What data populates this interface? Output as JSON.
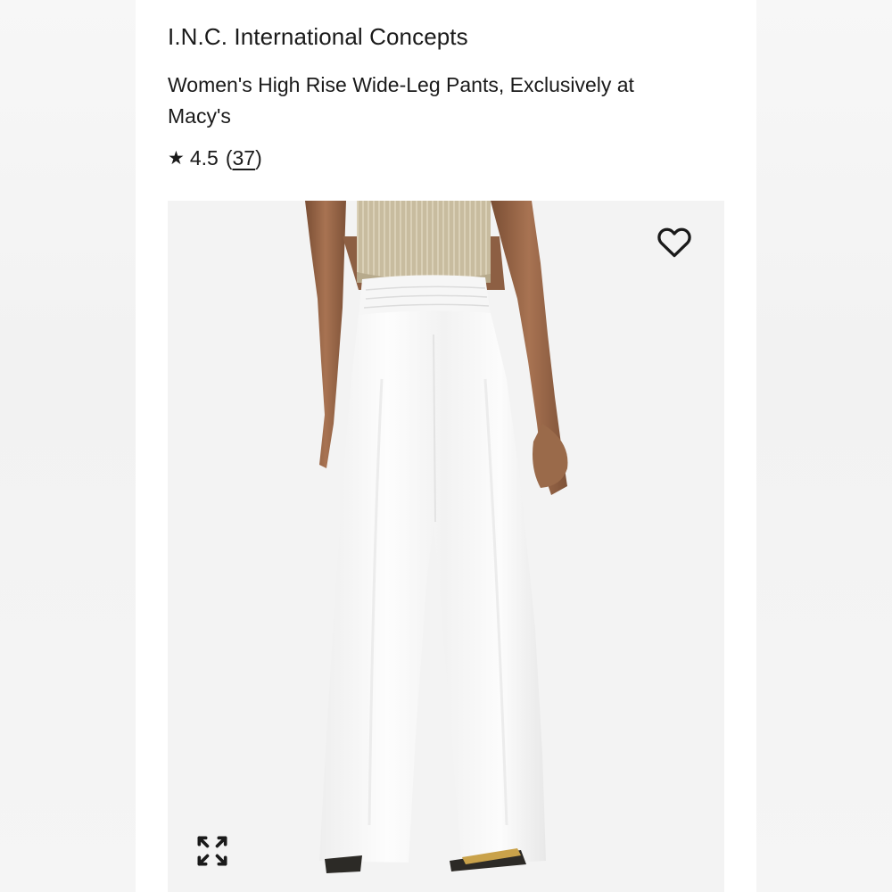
{
  "product": {
    "brand": "I.N.C. International Concepts",
    "name": "Women's High Rise Wide-Leg Pants, Exclusively at Macy's",
    "rating": {
      "star": "★",
      "value": "4.5",
      "open": "(",
      "count": "37",
      "close": ")"
    }
  },
  "image": {
    "wishlist_icon": "heart-outline-icon",
    "expand_icon": "expand-arrows-icon"
  },
  "colors": {
    "text": "#1a1a1a",
    "image_bg": "#f3f3f3",
    "pants": "#fbfbfb",
    "top": "#c9bca0",
    "skin": "#9a6a4a"
  }
}
